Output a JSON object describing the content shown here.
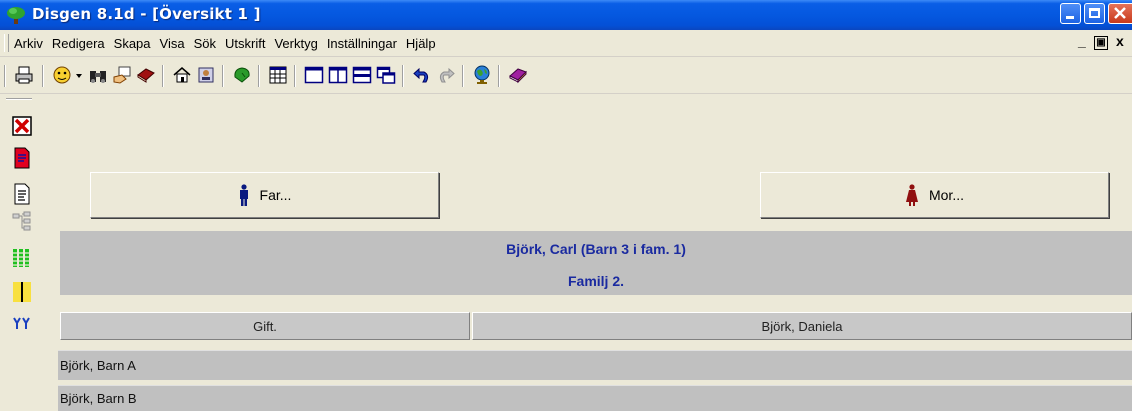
{
  "window": {
    "title": "Disgen 8.1d - [Översikt 1 ]"
  },
  "menu": [
    {
      "label": "Arkiv"
    },
    {
      "label": "Redigera"
    },
    {
      "label": "Skapa"
    },
    {
      "label": "Visa"
    },
    {
      "label": "Sök"
    },
    {
      "label": "Utskrift"
    },
    {
      "label": "Verktyg"
    },
    {
      "label": "Inställningar"
    },
    {
      "label": "Hjälp"
    }
  ],
  "mdi_controls": {
    "minimize": "_",
    "restore": "ð",
    "close": "x"
  },
  "buttons": {
    "father": "Far...",
    "mother": "Mor..."
  },
  "person": {
    "name": "Björk, Carl (Barn 3 i fam. 1)",
    "family": "Familj 2."
  },
  "family_header": {
    "status": "Gift.",
    "spouse": "Björk, Daniela"
  },
  "children": [
    "Björk, Barn A",
    "Björk, Barn B"
  ],
  "toolbar_icons": [
    "print-icon",
    "person-icon",
    "dropdown-arrow-icon",
    "binoculars-icon",
    "hand-card-icon",
    "books-icon",
    "house-icon",
    "address-book-icon",
    "tree-icon",
    "calendar-icon",
    "layout-single-icon",
    "layout-split-icon",
    "layout-horizontal-icon",
    "layout-cascade-icon",
    "undo-icon",
    "redo-icon",
    "globe-icon",
    "book-icon"
  ],
  "side_icons": [
    "delete-icon",
    "red-document-icon",
    "note-document-icon",
    "tree-chart-icon",
    "list-icon",
    "timeline-icon",
    "descendants-icon"
  ]
}
